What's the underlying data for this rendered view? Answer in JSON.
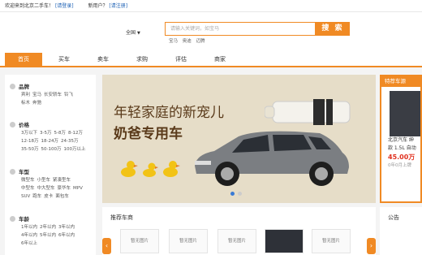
{
  "topbar": {
    "welcome": "欢迎来到北京二手车！",
    "login": "[请登录]",
    "newuser": "新用户？",
    "register": "[请注册]"
  },
  "header": {
    "city": "全国",
    "search_placeholder": "请输入关键词，如宝马",
    "search_button": "搜 索",
    "hotwords": [
      "宝马",
      "奥迪",
      "迈腾"
    ]
  },
  "nav": {
    "items": [
      {
        "label": "首页",
        "active": true
      },
      {
        "label": "买车",
        "active": false
      },
      {
        "label": "卖车",
        "active": false
      },
      {
        "label": "求购",
        "active": false
      },
      {
        "label": "评估",
        "active": false
      },
      {
        "label": "商家",
        "active": false
      }
    ]
  },
  "sidebar": {
    "categories": [
      {
        "title": "品牌",
        "links": [
          [
            "宾利",
            "宝马",
            "长安轿车",
            "铃飞"
          ],
          [
            "标木",
            "奔驰"
          ]
        ]
      },
      {
        "title": "价格",
        "links": [
          [
            "3万以下",
            "3-5万",
            "5-8万",
            "8-12万"
          ],
          [
            "12-18万",
            "18-24万",
            "24-35万"
          ],
          [
            "35-50万",
            "50-100万",
            "100万以上"
          ]
        ]
      },
      {
        "title": "车型",
        "links": [
          [
            "微型车",
            "小型车",
            "紧凑型车"
          ],
          [
            "中型车",
            "中大型车",
            "豪华车",
            "MPV"
          ],
          [
            "SUV",
            "跑车",
            "皮卡",
            "面包车"
          ]
        ]
      },
      {
        "title": "车龄",
        "links": [
          [
            "1年以内",
            "2年以内",
            "3年以内"
          ],
          [
            "4年以内",
            "5年以内",
            "6年以内"
          ],
          [
            "6年以上"
          ]
        ]
      }
    ]
  },
  "banner": {
    "line1": "年轻家庭的新宠儿",
    "line2": "奶爸专用车",
    "dots": 2,
    "active_dot": 0
  },
  "recommend": {
    "title": "推荐车商",
    "items": [
      "暂无图片",
      "暂无图片",
      "暂无图片",
      "",
      "暂无图片"
    ],
    "prev_icon": "‹",
    "next_icon": "›"
  },
  "special": {
    "title": "特荐车源",
    "car_name": "北京汽车 绅",
    "car_detail": "款 1.5L 自动",
    "price": "45.00万",
    "old": "0年0月上牌"
  },
  "notice": {
    "title": "公告"
  },
  "colors": {
    "accent": "#f08a24",
    "link": "#1a5fb4",
    "price": "#e0301e"
  }
}
